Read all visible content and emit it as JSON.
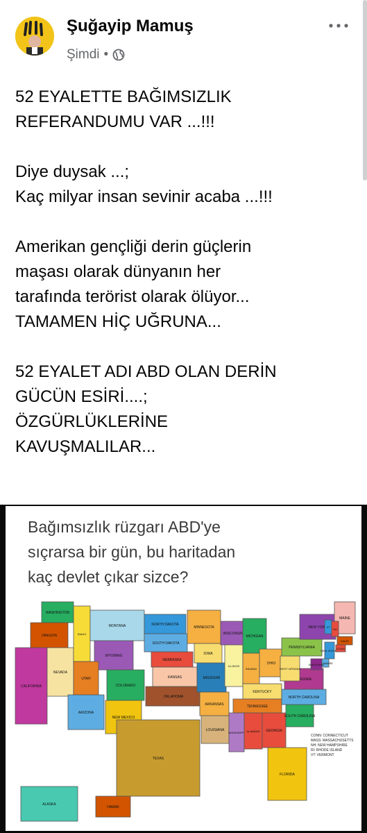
{
  "post": {
    "author": "Şuğayip Mamuş",
    "timestamp": "Şimdi",
    "separator": "•",
    "paragraphs": [
      [
        "52 EYALETTE BAĞIMSIZLIK",
        "REFERANDUMU VAR ...!!!"
      ],
      [
        "Diye duysak ...;",
        "Kaç milyar insan sevinir acaba ...!!!"
      ],
      [
        "Amerikan gençliği derin güçlerin",
        "maşası olarak dünyanın her",
        "tarafında terörist olarak ölüyor...",
        "TAMAMEN HİÇ UĞRUNA..."
      ],
      [
        "52 EYALET ADI ABD OLAN DERİN",
        "GÜCÜN ESİRİ....;",
        "ÖZGÜRLÜKLERİNE",
        "KAVUŞMALILAR..."
      ]
    ]
  },
  "image": {
    "caption_lines": [
      "Bağımsızlık rüzgarı ABD'ye",
      "sıçrarsa bir gün, bu haritadan",
      "kaç devlet çıkar sizce?"
    ],
    "states": [
      "WASHINGTON",
      "OREGON",
      "CALIFORNIA",
      "NEVADA",
      "IDAHO",
      "MONTANA",
      "WYOMING",
      "UTAH",
      "ARIZONA",
      "COLORADO",
      "NEW MEXICO",
      "NORTH DAKOTA",
      "SOUTH DAKOTA",
      "NEBRASKA",
      "KANSAS",
      "OKLAHOMA",
      "TEXAS",
      "MINNESOTA",
      "IOWA",
      "MISSOURI",
      "ARKANSAS",
      "LOUISIANA",
      "WISCONSIN",
      "ILLINOIS",
      "MICHIGAN",
      "INDIANA",
      "OHIO",
      "KENTUCKY",
      "TENNESSEE",
      "MISSISSIPPI",
      "ALABAMA",
      "GEORGIA",
      "FLORIDA",
      "SOUTH CAROLINA",
      "NORTH CAROLINA",
      "VIRGINIA",
      "WEST VIRGINIA",
      "PENNSYLVANIA",
      "NEW YORK",
      "MAINE",
      "VT",
      "NH",
      "MASS",
      "NEW JERSEY",
      "DELAWARE",
      "MARYLAND",
      "CONN",
      "ALASKA",
      "HAWAII"
    ],
    "legend_lines": [
      "CONN: CONNECTICUT",
      "MASS: MASSACHUSETTS",
      "NH: NEW HAMPSHIRE",
      "RI: RHODE ISLAND",
      "VT: VERMONT"
    ]
  },
  "icons": {
    "globe": "globe-icon",
    "more": "more-options-icon"
  },
  "colors": {
    "avatar_bg": "#f2c419",
    "meta_text": "#65676b",
    "image_border": "#0a0a0a"
  }
}
